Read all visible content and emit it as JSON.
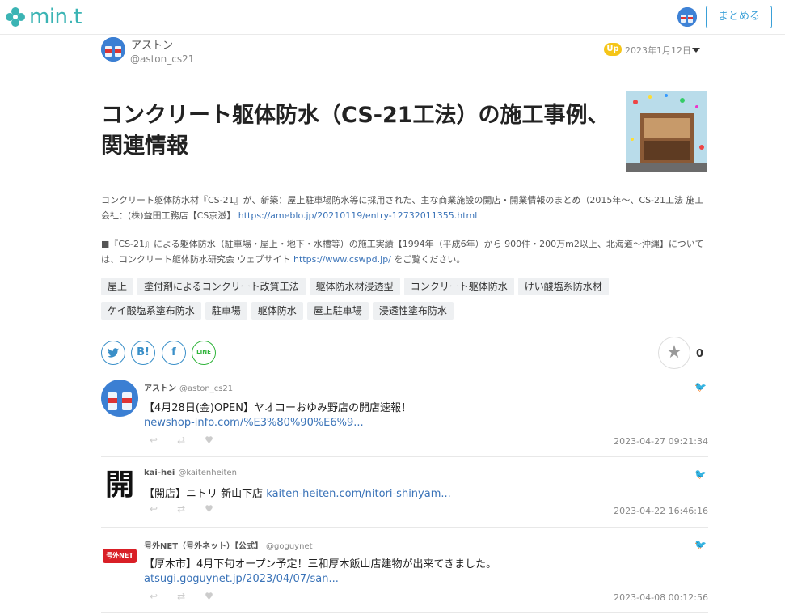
{
  "header": {
    "logo_text": "min.t",
    "matome_label": "まとめる"
  },
  "author": {
    "name": "アストン",
    "handle": "@aston_cs21",
    "up_label": "Up",
    "date": "2023年1月12日"
  },
  "article": {
    "title": "コンクリート躯体防水（CS-21工法）の施工事例、関連情報",
    "desc1_text": "コンクリート躯体防水材『CS-21』が、新築：屋上駐車場防水等に採用された、主な商業施設の開店・開業情報のまとめ（2015年～、CS-21工法 施工会社：(株)益田工務店【CS京滋】",
    "desc1_link": "https://ameblo.jp/20210119/entry-12732011355.html",
    "desc2_text": "■『CS-21』による躯体防水（駐車場・屋上・地下・水槽等）の施工実績【1994年（平成6年）から 900件・200万m2以上、北海道～沖縄】については、コンクリート躯体防水研究会 ウェブサイト",
    "desc2_link": "https://www.cswpd.jp/",
    "desc2_tail": "をご覧ください。"
  },
  "tags": [
    "屋上",
    "塗付剤によるコンクリート改質工法",
    "躯体防水材浸透型",
    "コンクリート躯体防水",
    "けい酸塩系防水材",
    "ケイ酸塩系塗布防水",
    "駐車場",
    "躯体防水",
    "屋上駐車場",
    "浸透性塗布防水"
  ],
  "share": {
    "twitter": "t",
    "hatena": "B!",
    "facebook": "f",
    "line": "LINE",
    "star_count": "0"
  },
  "tweets": [
    {
      "name": "アストン",
      "handle": "@aston_cs21",
      "text": "【4月28日(金)OPEN】ヤオコーおゆみ野店の開店速報！",
      "link": "newshop-info.com/%E3%80%90%E6%9...",
      "time": "2023-04-27 09:21:34"
    },
    {
      "name": "kai-hei",
      "handle": "@kaitenheiten",
      "text": "【開店】ニトリ 新山下店 ",
      "link": "kaiten-heiten.com/nitori-shinyam...",
      "time": "2023-04-22 16:46:16",
      "avatar_glyph": "開"
    },
    {
      "name": "号外NET（号外ネット）【公式】",
      "handle": "@goguynet",
      "text": "【厚木市】4月下旬オープン予定！三和厚木飯山店建物が出来てきました。",
      "link": "atsugi.goguynet.jp/2023/04/07/san...",
      "time": "2023-04-08 00:12:56",
      "avatar_text": "号外NET"
    }
  ],
  "colors": {
    "brand": "#3bb4b4",
    "link": "#3a73b8",
    "accent_button": "#3aa0d8",
    "up_badge": "#f5c518"
  }
}
